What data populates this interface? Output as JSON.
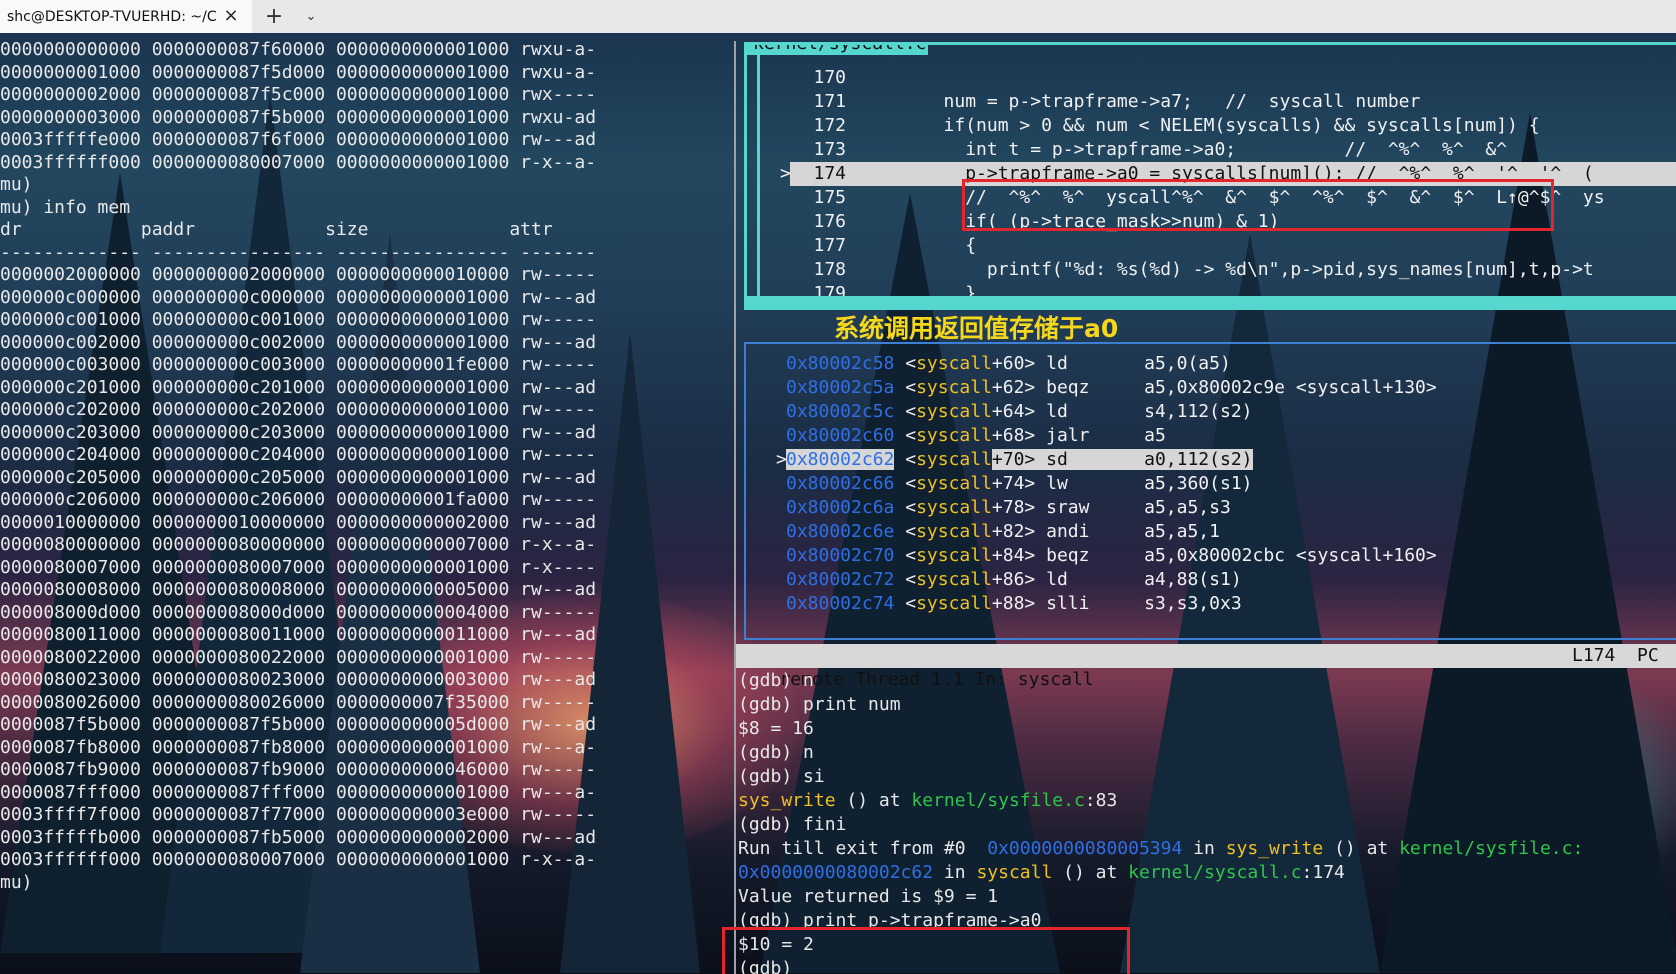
{
  "window": {
    "tab_title": "shc@DESKTOP-TVUERHD: ~/C",
    "close_icon": "×",
    "new_tab_icon": "+",
    "dropdown_icon": "⌄"
  },
  "left_lines": [
    "0000000000000 0000000087f60000 0000000000001000 rwxu-a-",
    "0000000001000 0000000087f5d000 0000000000001000 rwxu-a-",
    "0000000002000 0000000087f5c000 0000000000001000 rwx----",
    "0000000003000 0000000087f5b000 0000000000001000 rwxu-ad",
    "0003fffffe000 0000000087f6f000 0000000000001000 rw---ad",
    "0003ffffff000 0000000080007000 0000000000001000 r-x--a-",
    "mu)",
    "mu) info mem",
    "dr           paddr            size             attr",
    "------------- ---------------- ---------------- -------",
    "0000002000000 0000000002000000 0000000000010000 rw-----",
    "000000c000000 000000000c000000 0000000000001000 rw---ad",
    "000000c001000 000000000c001000 0000000000001000 rw-----",
    "000000c002000 000000000c002000 0000000000001000 rw---ad",
    "000000c003000 000000000c003000 00000000001fe000 rw-----",
    "000000c201000 000000000c201000 0000000000001000 rw---ad",
    "000000c202000 000000000c202000 0000000000001000 rw-----",
    "000000c203000 000000000c203000 0000000000001000 rw---ad",
    "000000c204000 000000000c204000 0000000000001000 rw-----",
    "000000c205000 000000000c205000 0000000000001000 rw---ad",
    "000000c206000 000000000c206000 00000000001fa000 rw-----",
    "0000010000000 0000000010000000 0000000000002000 rw---ad",
    "0000080000000 0000000080000000 0000000000007000 r-x--a-",
    "0000080007000 0000000080007000 0000000000001000 r-x----",
    "0000080008000 0000000080008000 0000000000005000 rw---ad",
    "000008000d000 000000008000d000 0000000000004000 rw-----",
    "0000080011000 0000000080011000 0000000000011000 rw---ad",
    "0000080022000 0000000080022000 0000000000001000 rw-----",
    "0000080023000 0000000080023000 0000000000003000 rw---ad",
    "0000080026000 0000000080026000 0000000007f35000 rw-----",
    "0000087f5b000 0000000087f5b000 000000000005d000 rw---ad",
    "0000087fb8000 0000000087fb8000 0000000000001000 rw---a-",
    "0000087fb9000 0000000087fb9000 0000000000046000 rw-----",
    "0000087fff000 0000000087fff000 0000000000001000 rw---a-",
    "0003ffff7f000 0000000087f77000 000000000003e000 rw-----",
    "0003fffffb000 0000000087fb5000 0000000000002000 rw---ad",
    "0003ffffff000 0000000080007000 0000000000001000 r-x--a-",
    "mu)"
  ],
  "source_panel": {
    "title": "kernel/syscall.c",
    "current_marker": ">",
    "lines": [
      {
        "num": "170",
        "text": ""
      },
      {
        "num": "171",
        "text": "         num = p->trapframe->a7;   //  syscall number"
      },
      {
        "num": "172",
        "text": "         if(num > 0 && num < NELEM(syscalls) && syscalls[num]) {"
      },
      {
        "num": "173",
        "text": "           int t = p->trapframe->a0;          //  ^%^  %^  &^"
      },
      {
        "num": "174",
        "text": "           p->trapframe->a0 = syscalls[num](); //  ^%^  %^  '^  '^  ("
      },
      {
        "num": "175",
        "text": "           //  ^%^  %^  yscall^%^  &^  $^  ^%^  $^  &^  $^  L↑@^$^  ys"
      },
      {
        "num": "176",
        "text": "           if( (p->trace_mask>>num) & 1)"
      },
      {
        "num": "177",
        "text": "           {"
      },
      {
        "num": "178",
        "text": "             printf(\"%d: %s(%d) -> %d\\n\",p->pid,sys_names[num],t,p->t"
      },
      {
        "num": "179",
        "text": "           }"
      },
      {
        "num": "180",
        "text": ""
      }
    ]
  },
  "annotation": "系统调用返回值存储于a0",
  "asm_panel": {
    "current_marker": ">",
    "lines": [
      {
        "addr": "0x80002c58",
        "fn": "syscall",
        "off": "+60>",
        "op": "ld",
        "args": "a5,0(a5)"
      },
      {
        "addr": "0x80002c5a",
        "fn": "syscall",
        "off": "+62>",
        "op": "beqz",
        "args": "a5,0x80002c9e <syscall+130>"
      },
      {
        "addr": "0x80002c5c",
        "fn": "syscall",
        "off": "+64>",
        "op": "ld",
        "args": "s4,112(s2)"
      },
      {
        "addr": "0x80002c60",
        "fn": "syscall",
        "off": "+68>",
        "op": "jalr",
        "args": "a5"
      },
      {
        "addr": "0x80002c62",
        "fn": "syscall",
        "off": "+70>",
        "op": "sd",
        "args": "a0,112(s2)"
      },
      {
        "addr": "0x80002c66",
        "fn": "syscall",
        "off": "+74>",
        "op": "lw",
        "args": "a5,360(s1)"
      },
      {
        "addr": "0x80002c6a",
        "fn": "syscall",
        "off": "+78>",
        "op": "sraw",
        "args": "a5,a5,s3"
      },
      {
        "addr": "0x80002c6e",
        "fn": "syscall",
        "off": "+82>",
        "op": "andi",
        "args": "a5,a5,1"
      },
      {
        "addr": "0x80002c70",
        "fn": "syscall",
        "off": "+84>",
        "op": "beqz",
        "args": "a5,0x80002cbc <syscall+160>"
      },
      {
        "addr": "0x80002c72",
        "fn": "syscall",
        "off": "+86>",
        "op": "ld",
        "args": "a4,88(s1)"
      },
      {
        "addr": "0x80002c74",
        "fn": "syscall",
        "off": "+88>",
        "op": "slli",
        "args": "s3,s3,0x3"
      }
    ]
  },
  "status_bar": {
    "left": "remote Thread 1.1 In: syscall",
    "right": "L174  PC"
  },
  "gdb_lines": [
    "(gdb) n",
    "(gdb) print num",
    "$8 = 16",
    "(gdb) n",
    "(gdb) si",
    "SYSWRITE",
    "(gdb) fini",
    "RUNTILL",
    "RETSYSCALL",
    "Value returned is $9 = 1",
    "(gdb) print p->trapframe->a0",
    "$10 = 2",
    "(gdb)"
  ],
  "gdb_parts": {
    "sys_write_fn": "sys_write",
    "sys_write_mid": " () at ",
    "sys_write_file": "kernel/sysfile.c",
    "sys_write_end": ":83",
    "run_pre": "Run till exit from #0  ",
    "run_addr": "0x0000000080005394",
    "run_in": " in ",
    "run_fn": "sys_write",
    "run_at": " () at ",
    "run_file": "kernel/sysfile.c:",
    "ret_addr": "0x0000000080002c62",
    "ret_in": " in ",
    "ret_fn": "syscall",
    "ret_at": " () at ",
    "ret_file": "kernel/syscall.c",
    "ret_end": ":174"
  },
  "colors": {
    "accent_cyan": "#55d7d0",
    "highlight_red": "#e2262c",
    "annotation_yellow": "#f5d71c",
    "addr_blue": "#2f6fe6",
    "fn_yellow": "#f0c020",
    "file_green": "#2fc44a"
  }
}
